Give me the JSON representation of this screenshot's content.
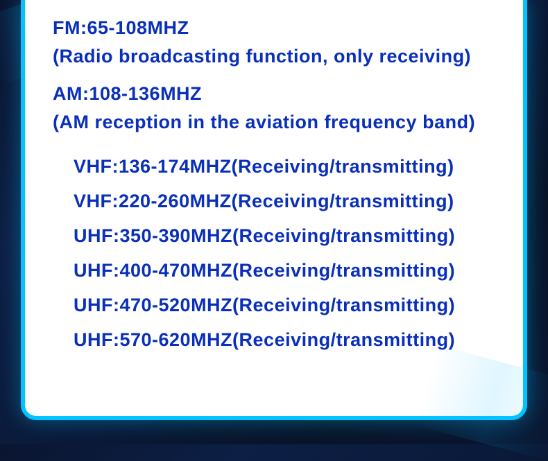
{
  "fm": {
    "title": "FM:65-108MHZ",
    "subtitle": "(Radio broadcasting function, only receiving)"
  },
  "am": {
    "title": "AM:108-136MHZ",
    "subtitle": "(AM reception in the aviation frequency band)"
  },
  "bands": [
    "VHF:136-174MHZ(Receiving/transmitting)",
    "VHF:220-260MHZ(Receiving/transmitting)",
    "UHF:350-390MHZ(Receiving/transmitting)",
    "UHF:400-470MHZ(Receiving/transmitting)",
    "UHF:470-520MHZ(Receiving/transmitting)",
    "UHF:570-620MHZ(Receiving/transmitting)"
  ]
}
